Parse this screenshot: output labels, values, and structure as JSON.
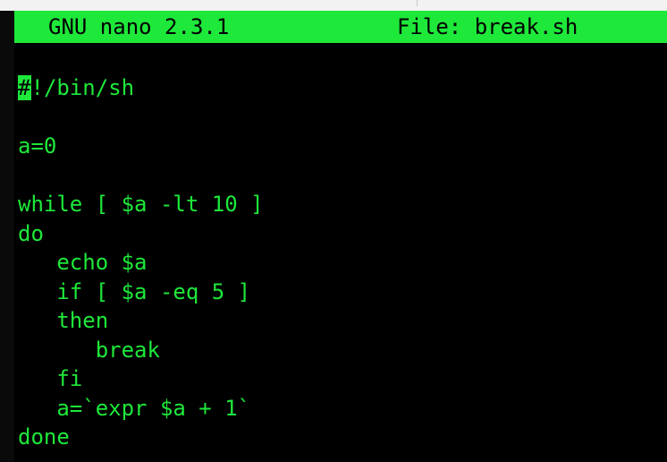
{
  "title_bar": {
    "app": "GNU nano 2.3.1",
    "file": "File: break.sh"
  },
  "editor": {
    "cursor_char": "#",
    "lines": [
      "!/bin/sh",
      "",
      "a=0",
      "",
      "while [ $a -lt 10 ]",
      "do",
      "   echo $a",
      "   if [ $a -eq 5 ]",
      "   then",
      "      break",
      "   fi",
      "   a=`expr $a + 1`",
      "done"
    ]
  },
  "colors": {
    "text": "#1ee83a",
    "background": "#000000",
    "title_bar_bg": "#1ee83a"
  }
}
